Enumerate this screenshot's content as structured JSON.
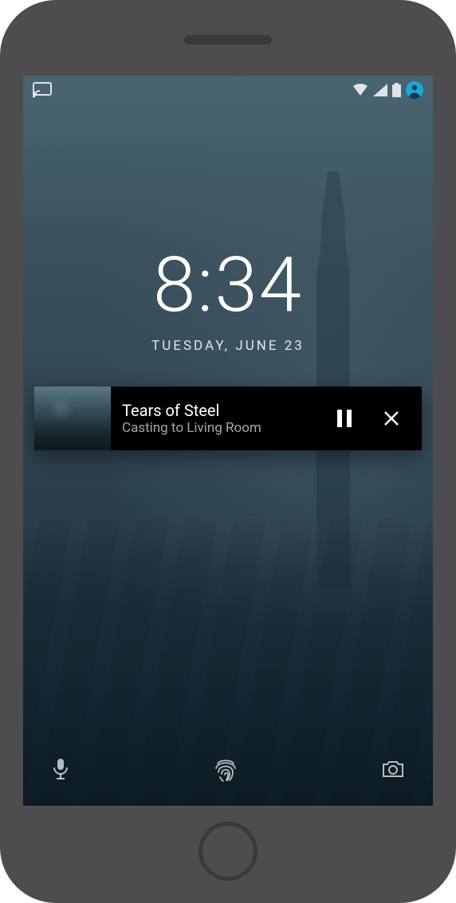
{
  "status": {
    "cast_icon": "cast-icon",
    "wifi_icon": "wifi-icon",
    "cell_icon": "cell-signal-icon",
    "battery_icon": "battery-icon",
    "profile_icon": "profile-icon",
    "accent_color": "#1aa8d8"
  },
  "clock": {
    "time": "8:34",
    "date": "TUESDAY, JUNE 23"
  },
  "media": {
    "title": "Tears of Steel",
    "subtitle": "Casting to Living Room",
    "pause_icon": "pause-icon",
    "close_icon": "close-icon",
    "thumb_alt": "media-thumbnail"
  },
  "bottom": {
    "voice_icon": "mic-icon",
    "fingerprint_icon": "fingerprint-icon",
    "camera_icon": "camera-icon"
  }
}
